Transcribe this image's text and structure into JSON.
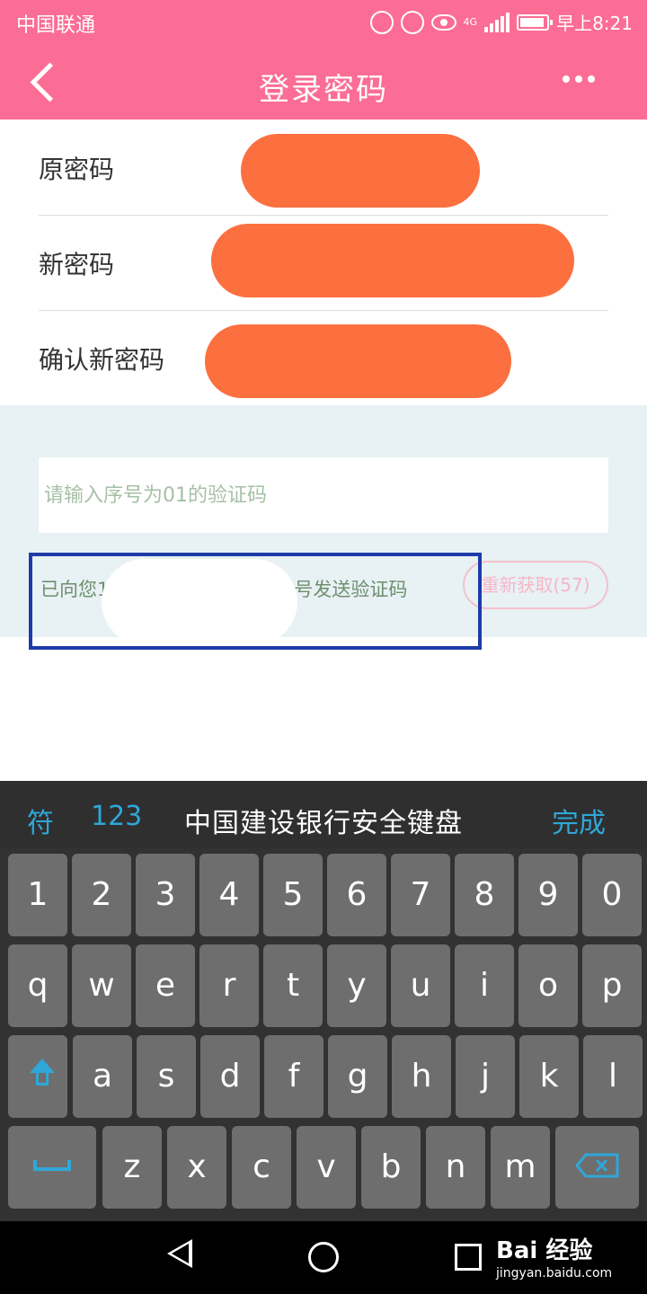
{
  "status_bar": {
    "carrier": "中国联通",
    "network": "4G",
    "time": "早上8:21"
  },
  "header": {
    "title": "登录密码"
  },
  "form": {
    "fields": [
      {
        "label": "原密码"
      },
      {
        "label": "新密码"
      },
      {
        "label": "确认新密码"
      }
    ]
  },
  "verify": {
    "placeholder": "请输入序号为01的验证码",
    "sent_prefix": "已向您1",
    "sent_suffix": "号发送验证码",
    "resend_label": "重新获取(57)"
  },
  "keyboard": {
    "symbols_label": "符",
    "numbers_label": "123",
    "title": "中国建设银行安全键盘",
    "done_label": "完成",
    "row1": [
      "1",
      "2",
      "3",
      "4",
      "5",
      "6",
      "7",
      "8",
      "9",
      "0"
    ],
    "row2": [
      "q",
      "w",
      "e",
      "r",
      "t",
      "y",
      "u",
      "i",
      "o",
      "p"
    ],
    "row3": [
      "a",
      "s",
      "d",
      "f",
      "g",
      "h",
      "j",
      "k",
      "l"
    ],
    "row4": [
      "z",
      "x",
      "c",
      "v",
      "b",
      "n",
      "m"
    ]
  },
  "watermark": {
    "logo": "Bai 经验",
    "url": "jingyan.baidu.com"
  },
  "colors": {
    "header": "#fb6d95",
    "mask": "#fc6f3f",
    "accent": "#2fa7d8",
    "highlight": "#1e3ba8"
  }
}
